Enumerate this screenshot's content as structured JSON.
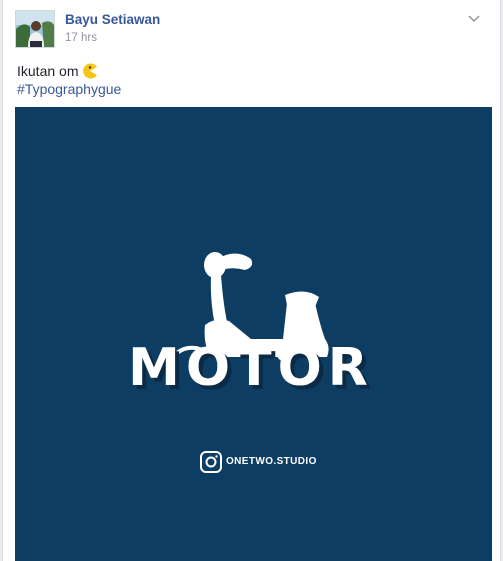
{
  "post": {
    "author": {
      "name": "Bayu Setiawan",
      "avatar_icon": "user-avatar"
    },
    "timestamp": "17 hrs",
    "text": "Ikutan om",
    "emoji_icon": "pacman-emoji-icon",
    "hashtag": "#Typographygue",
    "options_icon": "chevron-down-icon",
    "image": {
      "background": "#0d3d63",
      "logo_word": "MOTOR",
      "instagram_icon": "instagram-icon",
      "handle": "ONETWO.STUDIO"
    }
  },
  "colors": {
    "link": "#365899",
    "meta": "#90949c",
    "text": "#1d2129",
    "image_bg": "#0d3d63"
  }
}
